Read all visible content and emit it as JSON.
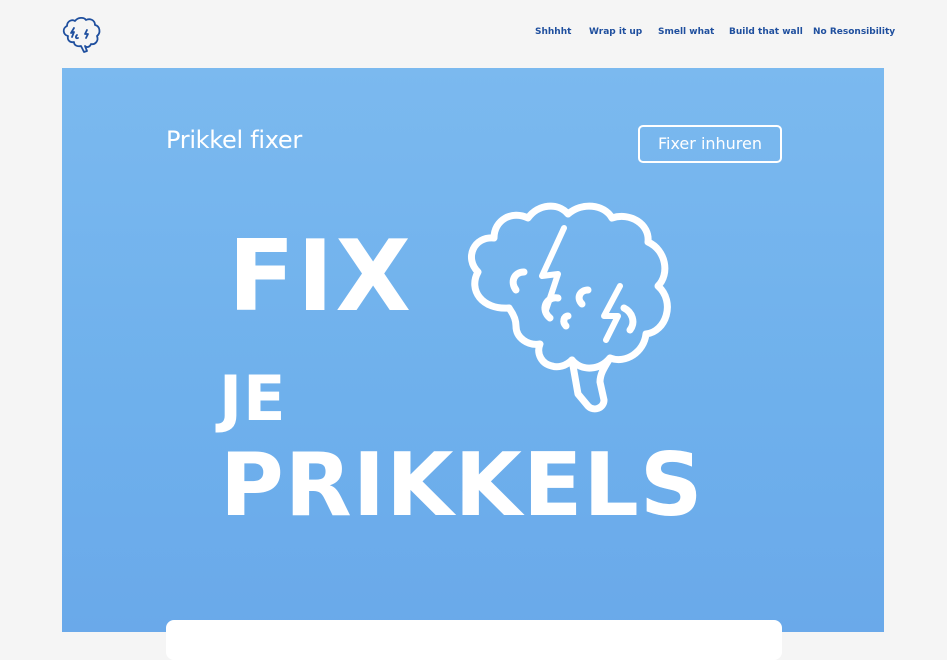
{
  "header": {
    "logo_icon": "brain-lightning-icon",
    "nav": [
      {
        "label": "Shhhht"
      },
      {
        "label": "Wrap it up"
      },
      {
        "label": "Smell what"
      },
      {
        "label": "Build that wall"
      },
      {
        "label": "No  Resonsibility"
      }
    ]
  },
  "hero": {
    "title": "Prikkel fixer",
    "cta_label": "Fixer inhuren",
    "headline": {
      "line1": "FIX",
      "line2": "JE",
      "line3": "PRIKKELS"
    },
    "illustration_icon": "brain-lightning-icon"
  },
  "colors": {
    "page_background": "#f5f5f5",
    "hero_background": "#74b4ee",
    "nav_text": "#1f4f9e",
    "hero_text": "#ffffff"
  }
}
